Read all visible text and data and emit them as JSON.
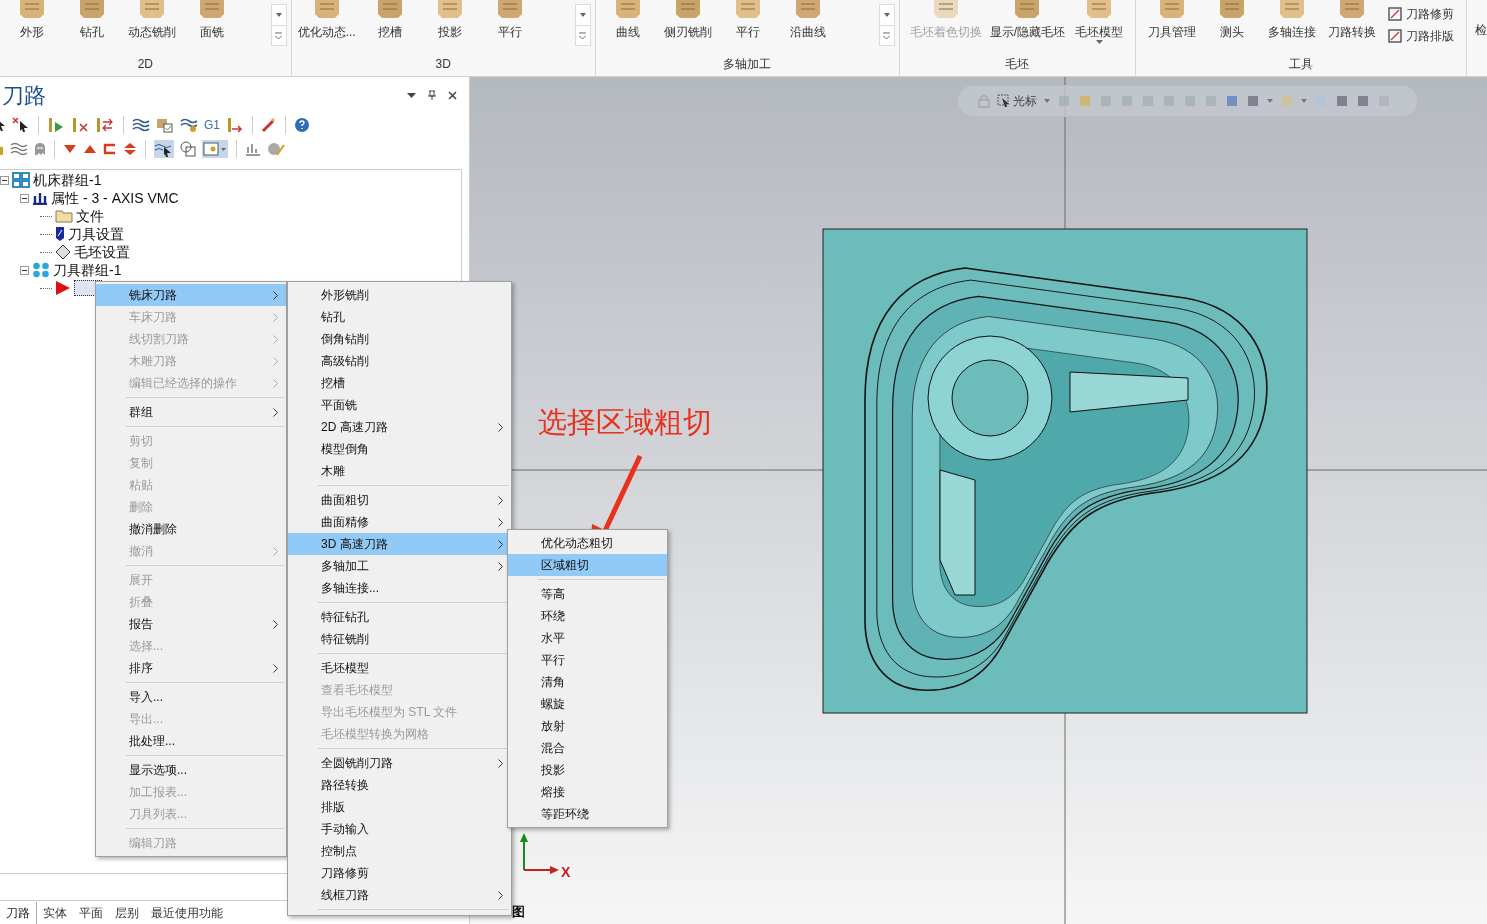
{
  "ribbon": {
    "groups": [
      {
        "label": "2D",
        "kind": "gallery",
        "buttons": [
          {
            "label": "外形",
            "kind": "large"
          },
          {
            "label": "钻孔",
            "kind": "large"
          },
          {
            "label": "动态铣削",
            "kind": "large"
          },
          {
            "label": "面铣",
            "kind": "large"
          }
        ]
      },
      {
        "label": "3D",
        "kind": "gallery",
        "buttons": [
          {
            "label": "优化动态...",
            "kind": "large"
          },
          {
            "label": "挖槽",
            "kind": "large"
          },
          {
            "label": "投影",
            "kind": "large"
          },
          {
            "label": "平行",
            "kind": "large"
          }
        ]
      },
      {
        "label": "多轴加工",
        "kind": "gallery",
        "buttons": [
          {
            "label": "曲线",
            "kind": "large"
          },
          {
            "label": "侧刃铣削",
            "kind": "large"
          },
          {
            "label": "平行",
            "kind": "large"
          },
          {
            "label": "沿曲线",
            "kind": "large"
          }
        ]
      },
      {
        "label": "毛坯",
        "kind": "plain",
        "buttons": [
          {
            "label": "毛坯着色切换",
            "kind": "large",
            "disabled": true
          },
          {
            "label": "显示/隐藏毛坯",
            "kind": "large",
            "disabled": false
          },
          {
            "label": "毛坯模型",
            "kind": "dropdown",
            "disabled": false
          }
        ]
      },
      {
        "label": "工具",
        "kind": "plain",
        "buttons": [
          {
            "label": "刀具管理",
            "kind": "large"
          },
          {
            "label": "测头",
            "kind": "large"
          },
          {
            "label": "多轴连接",
            "kind": "large"
          },
          {
            "label": "刀路转换",
            "kind": "large"
          },
          {
            "label": "刀路修剪",
            "kind": "small"
          },
          {
            "label": "刀路排版",
            "kind": "small"
          }
        ]
      }
    ],
    "trailing_button": "检"
  },
  "panel": {
    "title": "刀路",
    "toolbar_text": "G1",
    "tree": [
      {
        "label": "机床群组-1",
        "kind": "machine",
        "expanded": true,
        "children": [
          {
            "label": "属性 - 3 - AXIS VMC",
            "kind": "properties",
            "expanded": true,
            "children": [
              {
                "label": "文件",
                "kind": "folder"
              },
              {
                "label": "刀具设置",
                "kind": "tool"
              },
              {
                "label": "毛坯设置",
                "kind": "stock"
              }
            ]
          },
          {
            "label": "刀具群组-1",
            "kind": "toolgroup",
            "expanded": true,
            "children": [
              {
                "kind": "operation"
              }
            ]
          }
        ]
      }
    ],
    "bottom_tabs": [
      {
        "label": "刀路",
        "selected": true
      },
      {
        "label": "实体",
        "selected": false
      },
      {
        "label": "平面",
        "selected": false
      },
      {
        "label": "层别",
        "selected": false
      },
      {
        "label": "最近使用功能",
        "selected": false
      }
    ]
  },
  "context_menu": [
    {
      "kind": "item",
      "label": "铣床刀路",
      "selected": true,
      "disabled": false,
      "submenu": true
    },
    {
      "kind": "item",
      "label": "车床刀路",
      "selected": false,
      "disabled": true,
      "submenu": true
    },
    {
      "kind": "item",
      "label": "线切割刀路",
      "selected": false,
      "disabled": true,
      "submenu": true
    },
    {
      "kind": "item",
      "label": "木雕刀路",
      "selected": false,
      "disabled": true,
      "submenu": true
    },
    {
      "kind": "item",
      "label": "编辑已经选择的操作",
      "selected": false,
      "disabled": true,
      "submenu": true
    },
    {
      "kind": "separator"
    },
    {
      "kind": "item",
      "label": "群组",
      "selected": false,
      "disabled": false,
      "submenu": true
    },
    {
      "kind": "separator"
    },
    {
      "kind": "item",
      "label": "剪切",
      "selected": false,
      "disabled": true,
      "submenu": false
    },
    {
      "kind": "item",
      "label": "复制",
      "selected": false,
      "disabled": true,
      "submenu": false
    },
    {
      "kind": "item",
      "label": "粘贴",
      "selected": false,
      "disabled": true,
      "submenu": false
    },
    {
      "kind": "item",
      "label": "删除",
      "selected": false,
      "disabled": true,
      "submenu": false
    },
    {
      "kind": "item",
      "label": "撤消删除",
      "selected": false,
      "disabled": false,
      "submenu": false
    },
    {
      "kind": "item",
      "label": "撤消",
      "selected": false,
      "disabled": true,
      "submenu": true
    },
    {
      "kind": "separator"
    },
    {
      "kind": "item",
      "label": "展开",
      "selected": false,
      "disabled": true,
      "submenu": false
    },
    {
      "kind": "item",
      "label": "折叠",
      "selected": false,
      "disabled": true,
      "submenu": false
    },
    {
      "kind": "item",
      "label": "报告",
      "selected": false,
      "disabled": false,
      "submenu": true
    },
    {
      "kind": "item",
      "label": "选择...",
      "selected": false,
      "disabled": true,
      "submenu": false
    },
    {
      "kind": "item",
      "label": "排序",
      "selected": false,
      "disabled": false,
      "submenu": true
    },
    {
      "kind": "separator"
    },
    {
      "kind": "item",
      "label": "导入...",
      "selected": false,
      "disabled": false,
      "submenu": false
    },
    {
      "kind": "item",
      "label": "导出...",
      "selected": false,
      "disabled": true,
      "submenu": false
    },
    {
      "kind": "item",
      "label": "批处理...",
      "selected": false,
      "disabled": false,
      "submenu": false
    },
    {
      "kind": "separator"
    },
    {
      "kind": "item",
      "label": "显示选项...",
      "selected": false,
      "disabled": false,
      "submenu": false
    },
    {
      "kind": "item",
      "label": "加工报表...",
      "selected": false,
      "disabled": true,
      "submenu": false
    },
    {
      "kind": "item",
      "label": "刀具列表...",
      "selected": false,
      "disabled": true,
      "submenu": false
    },
    {
      "kind": "separator"
    },
    {
      "kind": "item",
      "label": "编辑刀路",
      "selected": false,
      "disabled": true,
      "submenu": false
    }
  ],
  "mill_submenu": [
    {
      "kind": "item",
      "label": "外形铣削",
      "selected": false,
      "disabled": false,
      "submenu": false
    },
    {
      "kind": "item",
      "label": "钻孔",
      "selected": false,
      "disabled": false,
      "submenu": false
    },
    {
      "kind": "item",
      "label": "倒角钻削",
      "selected": false,
      "disabled": false,
      "submenu": false
    },
    {
      "kind": "item",
      "label": "高级钻削",
      "selected": false,
      "disabled": false,
      "submenu": false
    },
    {
      "kind": "item",
      "label": "挖槽",
      "selected": false,
      "disabled": false,
      "submenu": false
    },
    {
      "kind": "item",
      "label": "平面铣",
      "selected": false,
      "disabled": false,
      "submenu": false
    },
    {
      "kind": "item",
      "label": "2D 高速刀路",
      "selected": false,
      "disabled": false,
      "submenu": true
    },
    {
      "kind": "item",
      "label": "模型倒角",
      "selected": false,
      "disabled": false,
      "submenu": false
    },
    {
      "kind": "item",
      "label": "木雕",
      "selected": false,
      "disabled": false,
      "submenu": false
    },
    {
      "kind": "separator"
    },
    {
      "kind": "item",
      "label": "曲面粗切",
      "selected": false,
      "disabled": false,
      "submenu": true
    },
    {
      "kind": "item",
      "label": "曲面精修",
      "selected": false,
      "disabled": false,
      "submenu": true
    },
    {
      "kind": "item",
      "label": "3D 高速刀路",
      "selected": true,
      "disabled": false,
      "submenu": true
    },
    {
      "kind": "item",
      "label": "多轴加工",
      "selected": false,
      "disabled": false,
      "submenu": true
    },
    {
      "kind": "item",
      "label": "多轴连接...",
      "selected": false,
      "disabled": false,
      "submenu": false
    },
    {
      "kind": "separator"
    },
    {
      "kind": "item",
      "label": "特征钻孔",
      "selected": false,
      "disabled": false,
      "submenu": false
    },
    {
      "kind": "item",
      "label": "特征铣削",
      "selected": false,
      "disabled": false,
      "submenu": false
    },
    {
      "kind": "separator"
    },
    {
      "kind": "item",
      "label": "毛坯模型",
      "selected": false,
      "disabled": false,
      "submenu": false
    },
    {
      "kind": "item",
      "label": "查看毛坯模型",
      "selected": false,
      "disabled": true,
      "submenu": false
    },
    {
      "kind": "item",
      "label": "导出毛坯模型为 STL 文件",
      "selected": false,
      "disabled": true,
      "submenu": false
    },
    {
      "kind": "item",
      "label": "毛坯模型转换为网格",
      "selected": false,
      "disabled": true,
      "submenu": false
    },
    {
      "kind": "separator"
    },
    {
      "kind": "item",
      "label": "全圆铣削刀路",
      "selected": false,
      "disabled": false,
      "submenu": true
    },
    {
      "kind": "item",
      "label": "路径转换",
      "selected": false,
      "disabled": false,
      "submenu": false
    },
    {
      "kind": "item",
      "label": "排版",
      "selected": false,
      "disabled": false,
      "submenu": false
    },
    {
      "kind": "item",
      "label": "手动输入",
      "selected": false,
      "disabled": false,
      "submenu": false
    },
    {
      "kind": "item",
      "label": "控制点",
      "selected": false,
      "disabled": false,
      "submenu": false
    },
    {
      "kind": "item",
      "label": "刀路修剪",
      "selected": false,
      "disabled": false,
      "submenu": false
    },
    {
      "kind": "item",
      "label": "线框刀路",
      "selected": false,
      "disabled": false,
      "submenu": true
    },
    {
      "kind": "separator"
    }
  ],
  "hsm3d_submenu": [
    {
      "kind": "item",
      "label": "优化动态粗切",
      "selected": false,
      "disabled": false,
      "submenu": false
    },
    {
      "kind": "item",
      "label": "区域粗切",
      "selected": true,
      "disabled": false,
      "submenu": false
    },
    {
      "kind": "separator"
    },
    {
      "kind": "item",
      "label": "等高",
      "selected": false,
      "disabled": false,
      "submenu": false
    },
    {
      "kind": "item",
      "label": "环绕",
      "selected": false,
      "disabled": false,
      "submenu": false
    },
    {
      "kind": "item",
      "label": "水平",
      "selected": false,
      "disabled": false,
      "submenu": false
    },
    {
      "kind": "item",
      "label": "平行",
      "selected": false,
      "disabled": false,
      "submenu": false
    },
    {
      "kind": "item",
      "label": "清角",
      "selected": false,
      "disabled": false,
      "submenu": false
    },
    {
      "kind": "item",
      "label": "螺旋",
      "selected": false,
      "disabled": false,
      "submenu": false
    },
    {
      "kind": "item",
      "label": "放射",
      "selected": false,
      "disabled": false,
      "submenu": false
    },
    {
      "kind": "item",
      "label": "混合",
      "selected": false,
      "disabled": false,
      "submenu": false
    },
    {
      "kind": "item",
      "label": "投影",
      "selected": false,
      "disabled": false,
      "submenu": false
    },
    {
      "kind": "item",
      "label": "熔接",
      "selected": false,
      "disabled": false,
      "submenu": false
    },
    {
      "kind": "item",
      "label": "等距环绕",
      "selected": false,
      "disabled": false,
      "submenu": false
    }
  ],
  "viewport": {
    "toolbar_label": "光标",
    "axis_label": "X",
    "view_tab_fragment": "图"
  },
  "annotation": {
    "text": "选择区域粗切"
  }
}
